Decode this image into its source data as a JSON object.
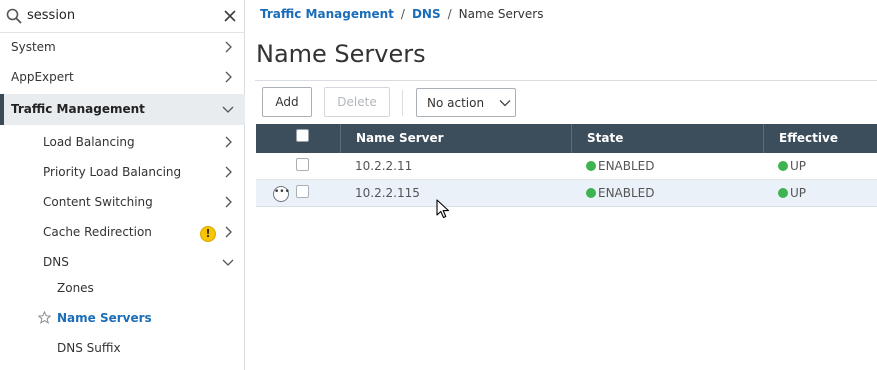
{
  "search": {
    "value": "session"
  },
  "sidebar": {
    "items": [
      {
        "label": "System"
      },
      {
        "label": "AppExpert"
      },
      {
        "label": "Traffic Management"
      },
      {
        "label": "Load Balancing"
      },
      {
        "label": "Priority Load Balancing"
      },
      {
        "label": "Content Switching"
      },
      {
        "label": "Cache Redirection",
        "badge": "!"
      },
      {
        "label": "DNS"
      },
      {
        "label": "Zones"
      },
      {
        "label": "Name Servers"
      },
      {
        "label": "DNS Suffix"
      }
    ]
  },
  "breadcrumb": {
    "items": [
      "Traffic Management",
      "DNS"
    ],
    "current": "Name Servers",
    "separator": "/"
  },
  "page": {
    "title": "Name Servers"
  },
  "toolbar": {
    "add_label": "Add",
    "delete_label": "Delete",
    "action_select": "No action"
  },
  "table": {
    "columns": [
      "Name Server",
      "State",
      "Effective State"
    ],
    "rows": [
      {
        "name_server": "10.2.2.11",
        "state": "ENABLED",
        "effective_state": "UP"
      },
      {
        "name_server": "10.2.2.115",
        "state": "ENABLED",
        "effective_state": "UP"
      }
    ]
  },
  "colors": {
    "header_bg": "#3c4d5c",
    "link": "#1b6db8",
    "status_green": "#3fb34f",
    "warning": "#f6c400",
    "selected_row": "#eaf1f8"
  },
  "icons": {
    "search": "search-icon",
    "clear": "close-icon",
    "expand": "chevron-right-icon",
    "collapse": "chevron-down-icon",
    "favorite": "star-icon",
    "row_menu": "more-icon"
  }
}
